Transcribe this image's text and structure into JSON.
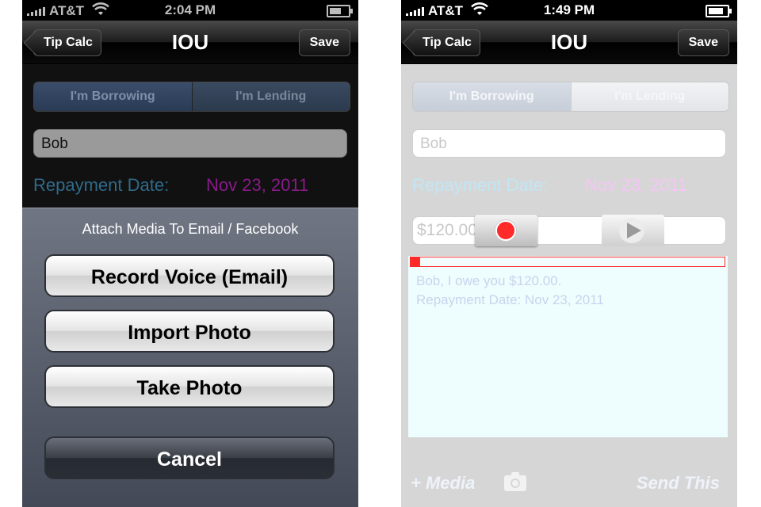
{
  "left": {
    "status": {
      "carrier": "AT&T",
      "time": "2:04 PM"
    },
    "nav": {
      "back_label": "Tip Calc",
      "title": "IOU",
      "save_label": "Save"
    },
    "segments": [
      "I'm Borrowing",
      "I'm Lending"
    ],
    "name_value": "Bob",
    "repayment": {
      "label": "Repayment Date:",
      "value": "Nov 23, 2011"
    },
    "sheet": {
      "title": "Attach Media To Email / Facebook",
      "buttons": [
        "Record Voice (Email)",
        "Import Photo",
        "Take Photo"
      ],
      "cancel_label": "Cancel"
    }
  },
  "right": {
    "status": {
      "carrier": "AT&T",
      "time": "1:49 PM"
    },
    "nav": {
      "back_label": "Tip Calc",
      "title": "IOU",
      "save_label": "Save"
    },
    "segments": [
      "I'm Borrowing",
      "I'm Lending"
    ],
    "name_placeholder": "Bob",
    "repayment": {
      "label": "Repayment Date:",
      "value": "Nov 23, 2011"
    },
    "amount_value": "$120.00",
    "message_lines": [
      "Bob, I owe you $120.00.",
      "Repayment Date: Nov 23, 2011"
    ],
    "footer": {
      "media_label": "+ Media",
      "send_label": "Send This"
    }
  },
  "colors": {
    "record_red": "#ff2a2a",
    "repay_label": "#2a6a8e",
    "repay_value": "#cc22cc"
  }
}
